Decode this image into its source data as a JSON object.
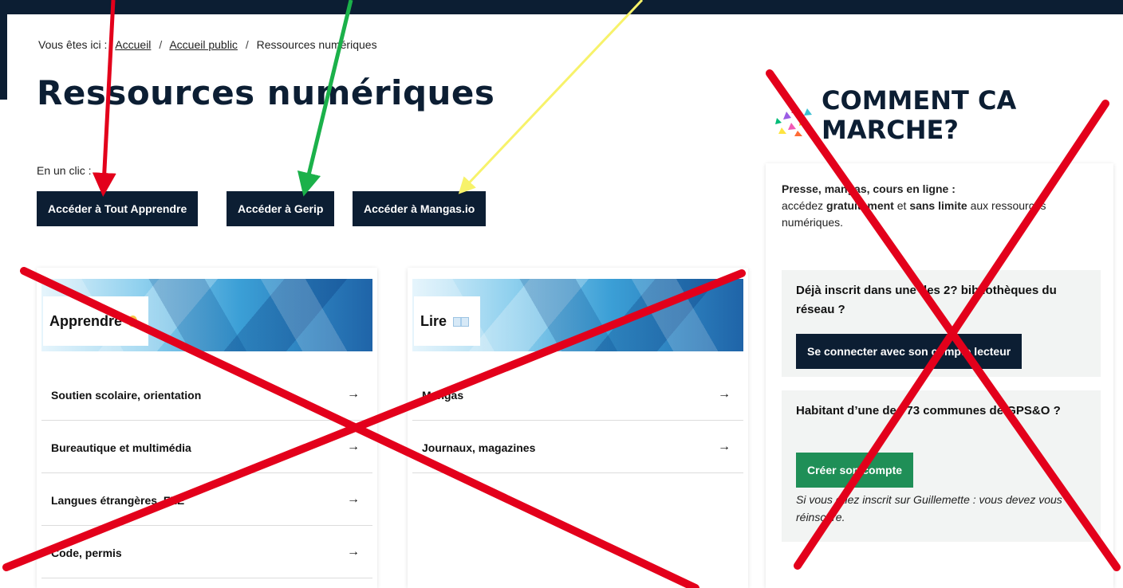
{
  "breadcrumb": {
    "prefix": "Vous êtes ici :",
    "items": [
      "Accueil",
      "Accueil public",
      "Ressources numériques"
    ]
  },
  "page_title": "Ressources numériques",
  "intro": "En un clic :",
  "quick_buttons": [
    "Accéder à Tout Apprendre",
    "Accéder à Gerip",
    "Accéder à Mangas.io"
  ],
  "cards": [
    {
      "title": "Apprendre",
      "icon": "lightbulb-icon",
      "items": [
        "Soutien scolaire, orientation",
        "Bureautique et multimédia",
        "Langues étrangères, FLE",
        "Code, permis"
      ]
    },
    {
      "title": "Lire",
      "icon": "open-book-icon",
      "items": [
        "Mangas",
        "Journaux, magazines"
      ]
    }
  ],
  "arrow": "→",
  "sidebar": {
    "title_line1": "COMMENT CA",
    "title_line2": "MARCHE?",
    "lead_strong": "Presse, mangas, cours en ligne :",
    "lead_a": "accédez ",
    "lead_b": "gratuitement",
    "lead_c": " et ",
    "lead_d": "sans limite",
    "lead_e": " aux ressources numériques.",
    "box1_title": "Déjà inscrit dans une des 2? bibliothèques du réseau ?",
    "box1_button": "Se connecter avec son compte lecteur",
    "box2_title": "Habitant d’une des 73 communes de GPS&O ?",
    "box2_button": "Créer son compte",
    "box2_note": "Si vous étiez inscrit sur Guillemette : vous devez vous réinscrire."
  },
  "colors": {
    "navy": "#0c1e33",
    "green": "#1f8f57",
    "annotation_red": "#e3001b",
    "annotation_green": "#1bb14a",
    "annotation_yellow": "#f7f26a"
  }
}
